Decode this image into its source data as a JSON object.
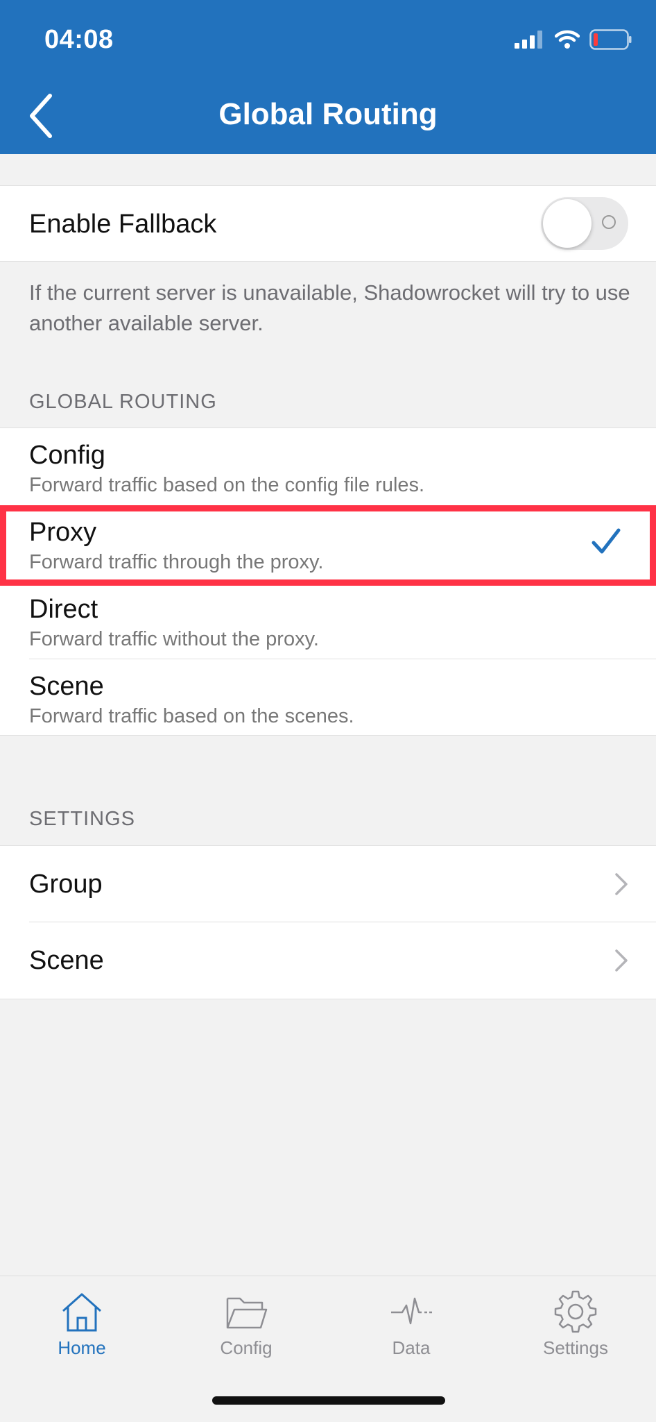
{
  "status_bar": {
    "time": "04:08"
  },
  "nav": {
    "title": "Global Routing"
  },
  "fallback": {
    "label": "Enable Fallback",
    "enabled": false,
    "note": "If the current server is unavailable, Shadowrocket will try to use another available server."
  },
  "routing": {
    "header": "GLOBAL ROUTING",
    "selected": "Proxy",
    "options": [
      {
        "title": "Config",
        "subtitle": "Forward traffic based on the config file rules."
      },
      {
        "title": "Proxy",
        "subtitle": "Forward traffic through the proxy."
      },
      {
        "title": "Direct",
        "subtitle": "Forward traffic without the proxy."
      },
      {
        "title": "Scene",
        "subtitle": "Forward traffic based on the scenes."
      }
    ]
  },
  "settings": {
    "header": "SETTINGS",
    "items": [
      {
        "label": "Group"
      },
      {
        "label": "Scene"
      }
    ]
  },
  "tabbar": {
    "active": "Home",
    "tabs": [
      {
        "label": "Home",
        "icon": "home-icon"
      },
      {
        "label": "Config",
        "icon": "folder-icon"
      },
      {
        "label": "Data",
        "icon": "activity-icon"
      },
      {
        "label": "Settings",
        "icon": "gear-icon"
      }
    ]
  },
  "colors": {
    "accent": "#2272bd",
    "highlight": "#ff3246"
  }
}
